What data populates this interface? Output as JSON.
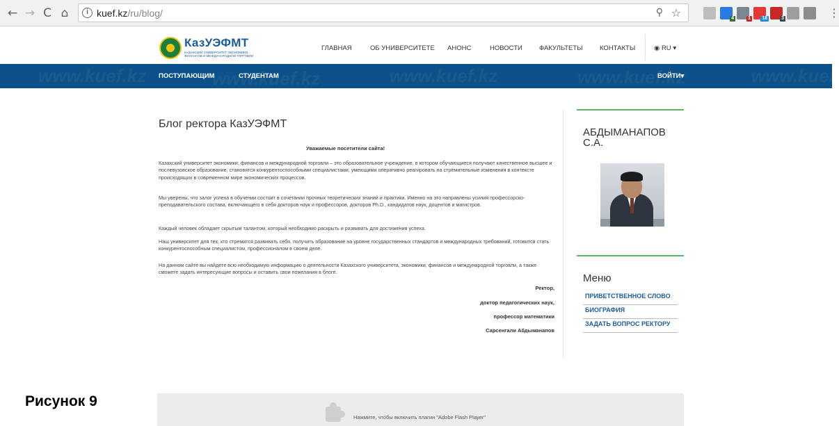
{
  "browser": {
    "back": "←",
    "forward": "→",
    "reload": "C",
    "home": "⌂",
    "info_glyph": "i",
    "url_host": "kuef.kz",
    "url_path": "/ru/blog/",
    "zoom_glyph": "⚲",
    "star_glyph": "☆",
    "menu_glyph": "⋮",
    "extensions": [
      {
        "name": "reader-ext-icon",
        "color": "#bdbdbd",
        "badge": ""
      },
      {
        "name": "s-ext-icon",
        "color": "#2a7ae2",
        "badge": "4",
        "badge_color": "#3c6e3c"
      },
      {
        "name": "tool-ext-icon",
        "color": "#7a8793",
        "badge": "1",
        "badge_color": "#c62828"
      },
      {
        "name": "g-ext-icon",
        "color": "#e53935",
        "badge": "18",
        "badge_color": "#1e88e5"
      },
      {
        "name": "shield-ext-icon",
        "color": "#c62828",
        "badge": "3",
        "badge_color": "#37474f"
      },
      {
        "name": "pdf-ext-icon",
        "color": "#9e9e9e",
        "badge": ""
      },
      {
        "name": "box-ext-icon",
        "color": "#8d8d8d",
        "badge": ""
      }
    ]
  },
  "header": {
    "logo_name": "КазУЭФМТ",
    "logo_sub": "КАЗАХСКИЙ УНИВЕРСИТЕТ ЭКОНОМИКИ, ФИНАНСОВ И МЕЖДУНАРОДНОЙ ТОРГОВЛИ",
    "nav": [
      "ГЛАВНАЯ",
      "ОБ УНИВЕРСИТЕТЕ",
      "АНОНС",
      "НОВОСТИ",
      "ФАКУЛЬТЕТЫ",
      "КОНТАКТЫ"
    ],
    "lang": "RU",
    "globe_glyph": "◉",
    "caret": "▾"
  },
  "bluebar": {
    "items": [
      "ПОСТУПАЮЩИМ",
      "СТУДЕНТАМ"
    ],
    "login": "ВОЙТИ",
    "watermark": "www.kuef.kz"
  },
  "main": {
    "title": "Блог ректора КазУЭФМТ",
    "greeting": "Уважаемые посетители сайта!",
    "paragraphs": [
      "Казахский университет экономики, финансов и международной торговли – это образовательное учреждение, в котором обучающиеся получают качественное высшее и послевузовское образование, становятся конкурентоспособными специалистами, умеющими оперативно реагировать на стремительные изменения в контексте происходящих в современном мире экономических процессов.",
      "Мы уверены, что залог успеха в обучении состоит в сочетании прочных теоретических знаний и практики. Именно на это направлены усилия профессорско-преподавательского состава, включающего в себя докторов наук и профессоров, докторов Ph.D., кандидатов наук, доцентов и магистров.",
      "Каждый человек обладает скрытым талантом, который необходимо раскрыть и развивать для достижения успеха.",
      "Наш университет для тех, кто стремится развивать себя, получить образование на уровне государственных стандартов и международных требований, готовится стать конкурентоспособным специалистом, профессионалом в своем деле.",
      "На данном сайте вы найдете всю необходимую информацию о деятельности Казахского университета, экономики, финансов и международной торговли, а также сможете задать интересующие вопросы и оставить свои пожелания в блоге."
    ],
    "signature": [
      "Ректор,",
      "доктор педагогических наук,",
      "профессор математики",
      "Сарсенгали Абдыманапов"
    ]
  },
  "sidebar": {
    "rector_name": "АБДЫМАНАПОВ С.А.",
    "menu_title": "Меню",
    "menu": [
      "ПРИВЕТСТВЕННОЕ СЛОВО",
      "БИОГРАФИЯ",
      "ЗАДАТЬ ВОПРОС РЕКТОРУ"
    ]
  },
  "footer": {
    "figure_label": "Рисунок 9",
    "flash_text": "Нажмите, чтобы включить плагин \"Adobe Flash Player\""
  }
}
